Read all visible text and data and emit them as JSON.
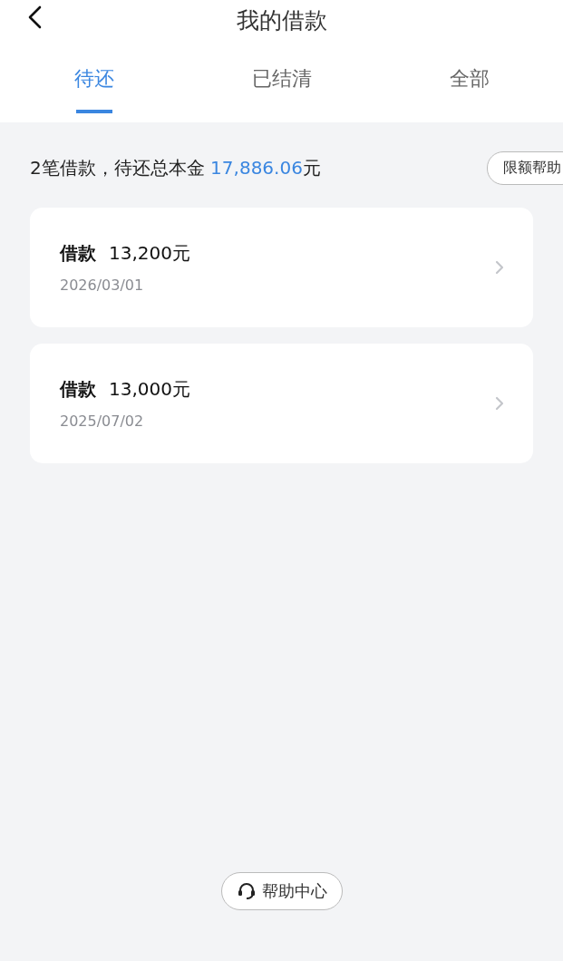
{
  "header": {
    "title": "我的借款"
  },
  "tabs": [
    {
      "label": "待还",
      "selected": true
    },
    {
      "label": "已结清",
      "selected": false
    },
    {
      "label": "全部",
      "selected": false
    }
  ],
  "summary": {
    "prefix": "2笔借款，待还总本金 ",
    "amount": "17,886.06",
    "unit": "元",
    "button": "限额帮助"
  },
  "loans": [
    {
      "label": "借款",
      "amount": "13,200元",
      "date": "2026/03/01"
    },
    {
      "label": "借款",
      "amount": "13,000元",
      "date": "2025/07/02"
    }
  ],
  "help_button": "帮助中心"
}
